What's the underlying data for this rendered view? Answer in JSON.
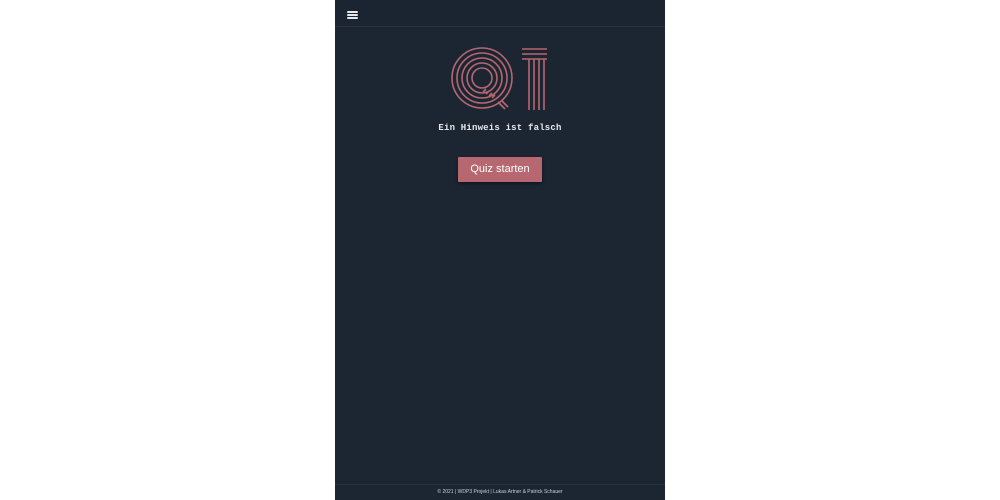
{
  "header": {
    "menu_icon": "hamburger-menu-icon"
  },
  "logo": {
    "icon": "q1-logo-icon",
    "color": "#b66770"
  },
  "tagline": "Ein Hinweis ist falsch",
  "start_button": {
    "label": "Quiz starten",
    "color": "#b66770"
  },
  "footer": {
    "text": "© 2021 | WDP3 Projekt | Lukas Artner & Patrick Schauer"
  },
  "colors": {
    "background": "#1c2633",
    "accent": "#b66770",
    "text": "#e8e8e8"
  }
}
